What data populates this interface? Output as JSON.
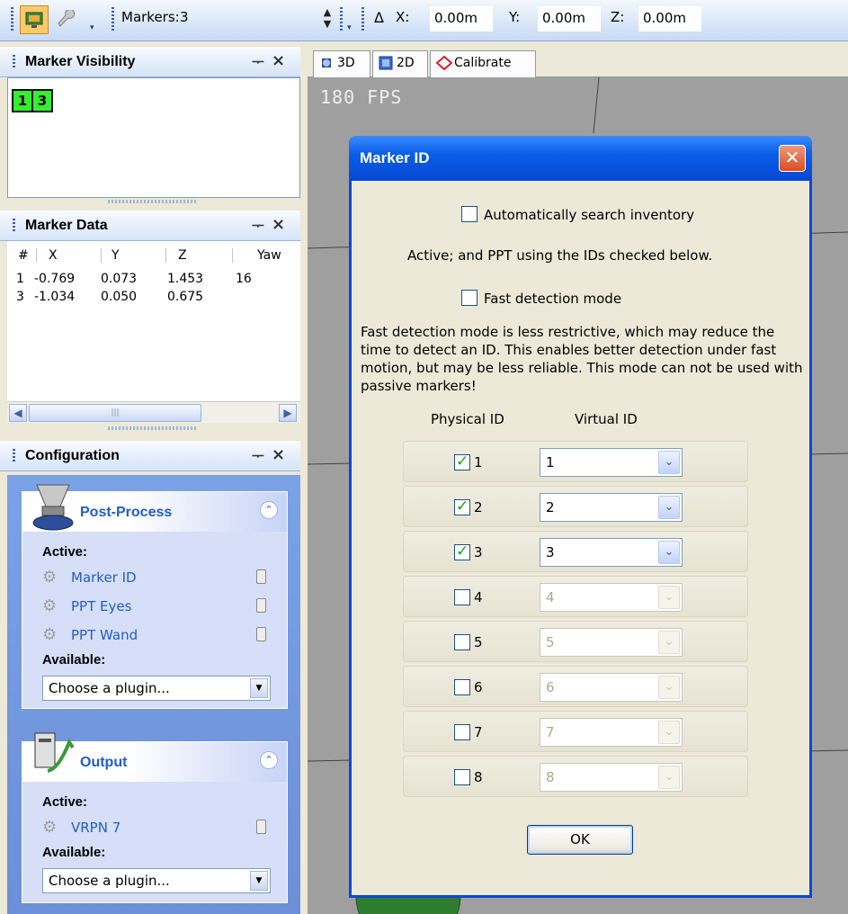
{
  "toolbar": {
    "markers_label": "Markers:",
    "markers_value": "3",
    "x_label": "X:",
    "x_value": "0.00m",
    "y_label": "Y:",
    "y_value": "0.00m",
    "z_label": "Z:",
    "z_value": "0.00m",
    "delta_symbol": "Δ"
  },
  "marker_visibility": {
    "title": "Marker Visibility",
    "markers": [
      "1",
      "3"
    ],
    "marker_color": "#33ee33"
  },
  "marker_data": {
    "title": "Marker Data",
    "columns": [
      "#",
      "X",
      "Y",
      "Z",
      "Yaw"
    ],
    "rows": [
      [
        "1",
        "-0.769",
        "0.073",
        "1.453",
        "16"
      ],
      [
        "3",
        "-1.034",
        "0.050",
        "0.675",
        ""
      ]
    ]
  },
  "configuration": {
    "title": "Configuration",
    "post_process": {
      "title": "Post-Process",
      "active_label": "Active:",
      "active": [
        "Marker ID",
        "PPT Eyes",
        "PPT Wand"
      ],
      "available_label": "Available:",
      "select_value": "Choose a plugin..."
    },
    "output": {
      "title": "Output",
      "active_label": "Active:",
      "active": [
        "VRPN 7"
      ],
      "available_label": "Available:",
      "select_value": "Choose a plugin..."
    }
  },
  "viewport": {
    "tabs": [
      "3D",
      "2D",
      "Calibrate"
    ],
    "fps": "180 FPS"
  },
  "dialog": {
    "title": "Marker ID",
    "auto_search_label": "Automatically search inventory",
    "auto_search_checked": false,
    "active_note": "Active; and PPT using the IDs checked below.",
    "fast_mode_label": "Fast detection mode",
    "fast_mode_checked": false,
    "fast_mode_description": "Fast detection mode is less restrictive, which may reduce the time to detect an ID. This enables better detection under fast motion, but may be less reliable. This mode can not be used with passive markers!",
    "physical_id_header": "Physical ID",
    "virtual_id_header": "Virtual ID",
    "ids": [
      {
        "physical": "1",
        "virtual": "1",
        "checked": true
      },
      {
        "physical": "2",
        "virtual": "2",
        "checked": true
      },
      {
        "physical": "3",
        "virtual": "3",
        "checked": true
      },
      {
        "physical": "4",
        "virtual": "4",
        "checked": false
      },
      {
        "physical": "5",
        "virtual": "5",
        "checked": false
      },
      {
        "physical": "6",
        "virtual": "6",
        "checked": false
      },
      {
        "physical": "7",
        "virtual": "7",
        "checked": false
      },
      {
        "physical": "8",
        "virtual": "8",
        "checked": false
      }
    ],
    "ok_label": "OK",
    "close_symbol": "✕"
  },
  "colors": {
    "title_bar": "#0a5ee8",
    "close_button": "#d94b22",
    "link_blue": "#215dc6",
    "viewport_bg": "#9f9f9f"
  }
}
